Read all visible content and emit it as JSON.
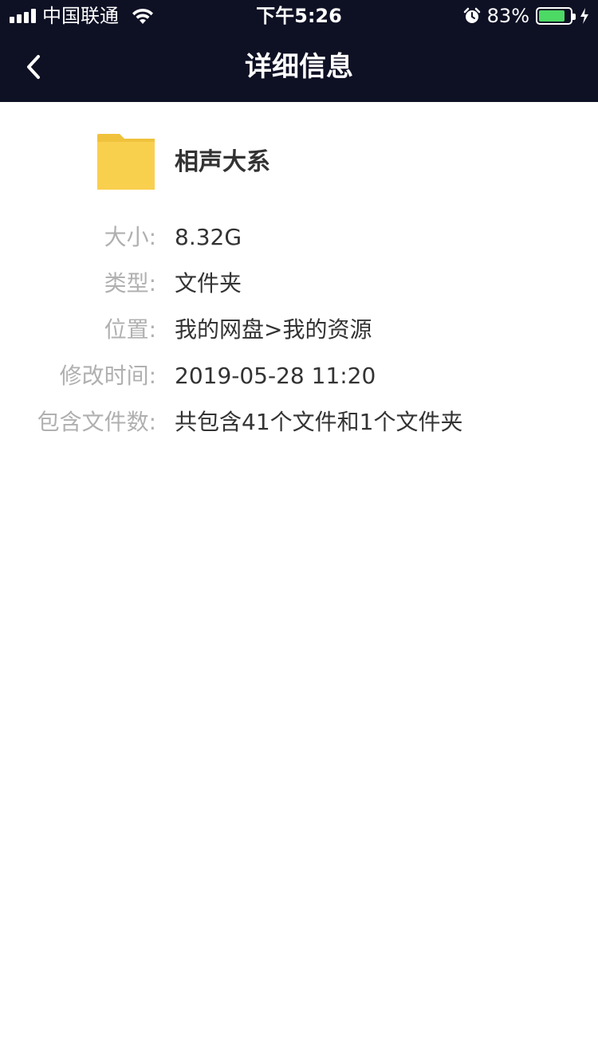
{
  "status_bar": {
    "carrier": "中国联通",
    "time": "下午5:26",
    "battery_percent_text": "83%",
    "battery_level": 0.83,
    "icons": [
      "signal-icon",
      "wifi-icon",
      "alarm-icon",
      "battery-icon",
      "charging-bolt-icon"
    ],
    "battery_color": "#4cd964"
  },
  "nav": {
    "title": "详细信息",
    "back_icon": "chevron-left-icon"
  },
  "folder": {
    "name": "相声大系",
    "icon": "folder-icon",
    "icon_color": "#f9cf4e"
  },
  "info": {
    "rows": [
      {
        "label": "大小:",
        "value": "8.32G"
      },
      {
        "label": "类型:",
        "value": "文件夹"
      },
      {
        "label": "位置:",
        "value": "我的网盘>我的资源"
      },
      {
        "label": "修改时间:",
        "value": "2019-05-28 11:20"
      },
      {
        "label": "包含文件数:",
        "value": "共包含41个文件和1个文件夹"
      }
    ]
  },
  "colors": {
    "header_bg": "#0e1024",
    "label_color": "#b0b0b0",
    "value_color": "#333333"
  }
}
